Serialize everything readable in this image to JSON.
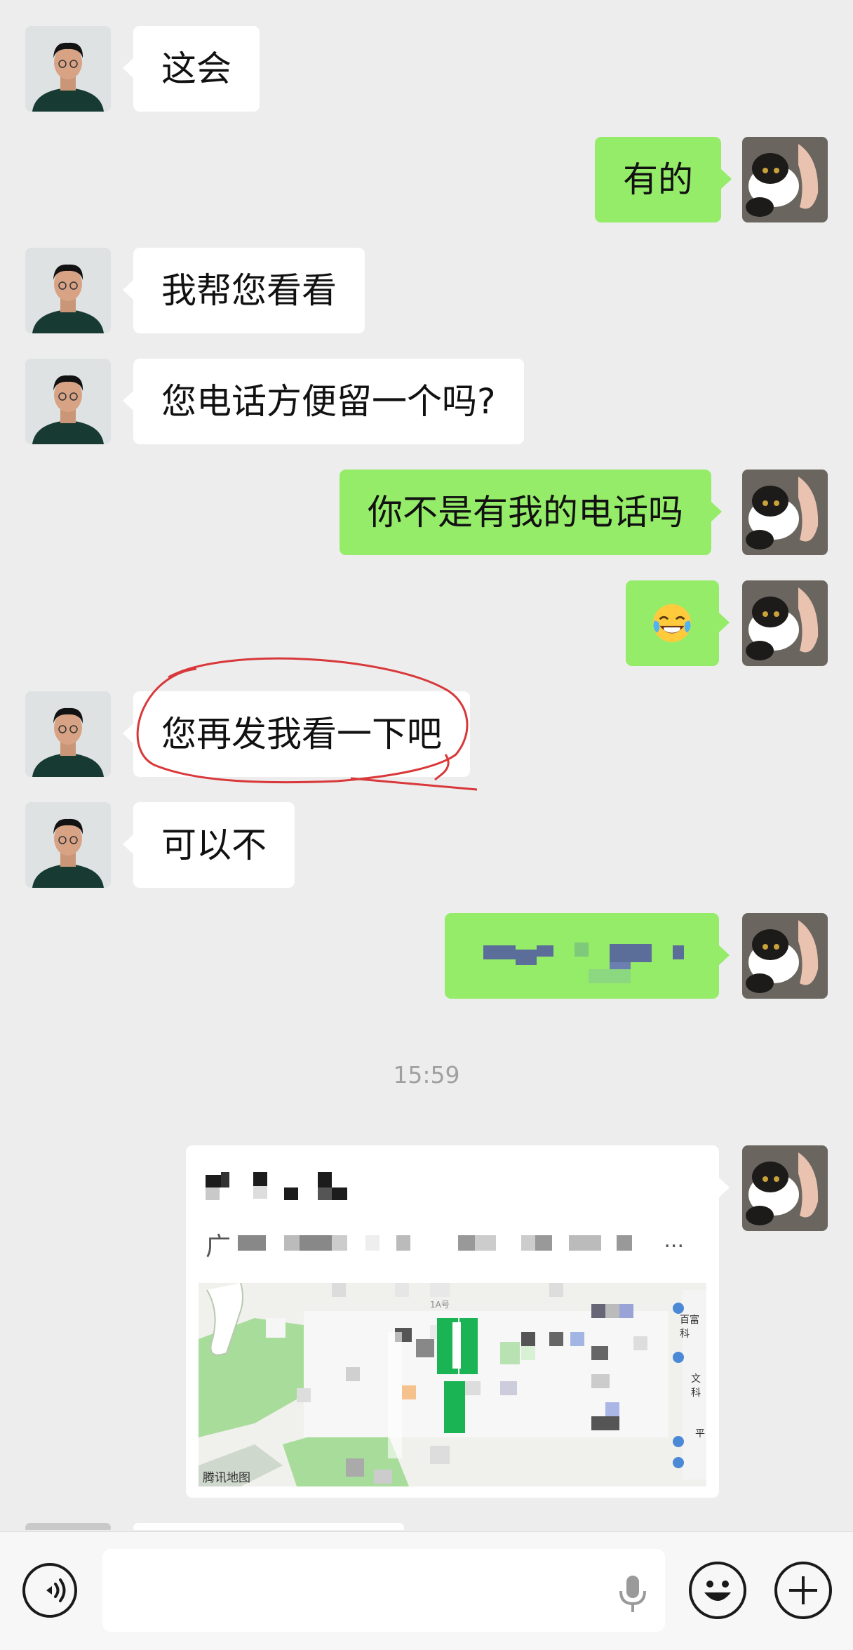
{
  "messages": [
    {
      "side": "in",
      "text": "这会"
    },
    {
      "side": "out",
      "text": "有的"
    },
    {
      "side": "in",
      "text": "我帮您看看"
    },
    {
      "side": "in",
      "text": "您电话方便留一个吗?"
    },
    {
      "side": "out",
      "text": "你不是有我的电话吗"
    },
    {
      "side": "out",
      "emoji": "tears-of-joy-emoji"
    },
    {
      "side": "in",
      "text": "您再发我看一下吧",
      "annotation": "red-circle"
    },
    {
      "side": "in",
      "text": "可以不"
    },
    {
      "side": "out",
      "text": "",
      "redacted": true
    }
  ],
  "timestamp": "15:59",
  "location_card": {
    "name": "",
    "address_prefix": "广",
    "ellipsis": "...",
    "map_brand": "腾讯地图",
    "map_labels": [
      "百富科",
      "文科",
      "平",
      "1A号"
    ]
  },
  "input_bar": {
    "voice_icon": "voice-toggle-icon",
    "mic_icon": "microphone-icon",
    "emoji_icon": "emoji-icon",
    "plus_icon": "plus-icon"
  },
  "colors": {
    "background": "#ededed",
    "outgoing_bubble": "#95ec69",
    "incoming_bubble": "#ffffff",
    "annotation": "#d9383a"
  }
}
